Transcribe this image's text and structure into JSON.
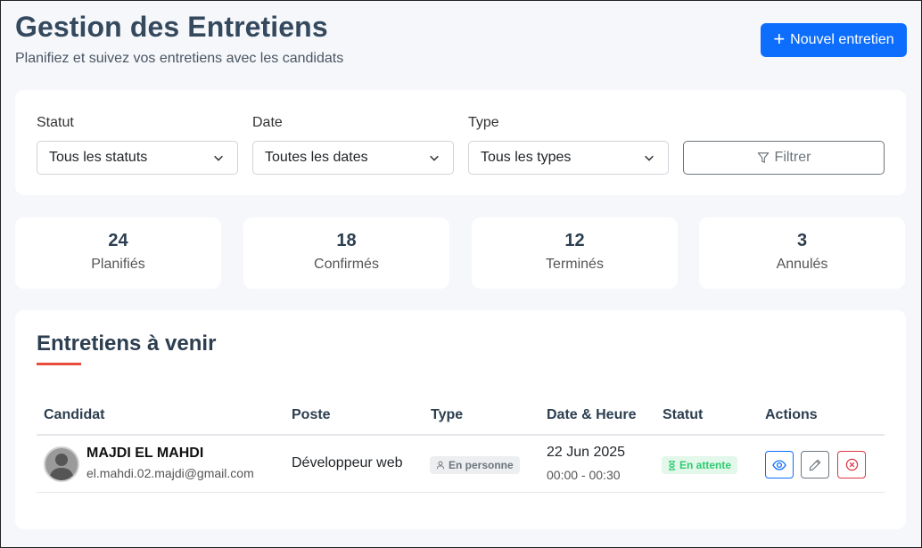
{
  "header": {
    "title": "Gestion des Entretiens",
    "subtitle": "Planifiez et suivez vos entretiens avec les candidats",
    "new_button": "Nouvel entretien"
  },
  "filters": {
    "status": {
      "label": "Statut",
      "value": "Tous les statuts"
    },
    "date": {
      "label": "Date",
      "value": "Toutes les dates"
    },
    "type": {
      "label": "Type",
      "value": "Tous les types"
    },
    "filter_button": "Filtrer"
  },
  "stats": [
    {
      "value": "24",
      "label": "Planifiés"
    },
    {
      "value": "18",
      "label": "Confirmés"
    },
    {
      "value": "12",
      "label": "Terminés"
    },
    {
      "value": "3",
      "label": "Annulés"
    }
  ],
  "upcoming": {
    "title": "Entretiens à venir",
    "columns": [
      "Candidat",
      "Poste",
      "Type",
      "Date & Heure",
      "Statut",
      "Actions"
    ],
    "rows": [
      {
        "name": "MAJDI EL MAHDI",
        "email": "el.mahdi.02.majdi@gmail.com",
        "position": "Développeur web",
        "type": "En personne",
        "date": "22 Jun 2025",
        "time": "00:00 - 00:30",
        "status": "En attente"
      }
    ]
  },
  "colors": {
    "primary": "#0d6efd",
    "accent_underline": "#e74c3c",
    "status_pending": "#2ecc71",
    "danger": "#dc3545"
  },
  "icons": [
    "plus-icon",
    "chevron-down-icon",
    "filter-icon",
    "user-icon",
    "hourglass-icon",
    "eye-icon",
    "pencil-icon",
    "x-circle-icon"
  ]
}
